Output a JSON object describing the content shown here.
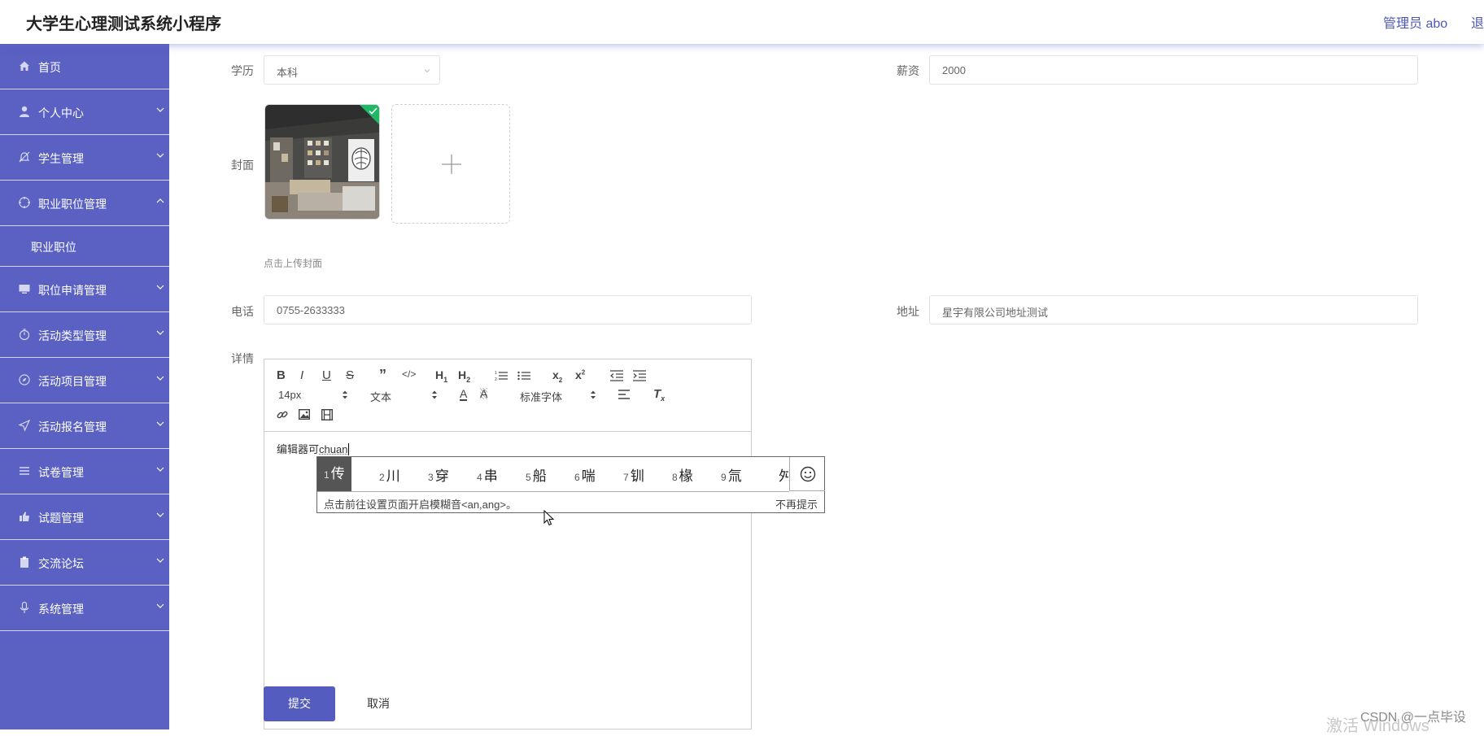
{
  "header": {
    "title": "大学生心理测试系统小程序",
    "user": "管理员 abo",
    "logout": "退"
  },
  "sidebar": {
    "items": [
      {
        "label": "首页",
        "icon": "home-icon"
      },
      {
        "label": "个人中心",
        "icon": "user-icon"
      },
      {
        "label": "学生管理",
        "icon": "bell-off-icon"
      },
      {
        "label": "职业职位管理",
        "icon": "compass-icon"
      },
      {
        "label": "职位申请管理",
        "icon": "monitor-icon"
      },
      {
        "label": "活动类型管理",
        "icon": "stopwatch-icon"
      },
      {
        "label": "活动项目管理",
        "icon": "compass-icon"
      },
      {
        "label": "活动报名管理",
        "icon": "send-icon"
      },
      {
        "label": "试卷管理",
        "icon": "list-icon"
      },
      {
        "label": "试题管理",
        "icon": "thumb-icon"
      },
      {
        "label": "交流论坛",
        "icon": "clipboard-icon"
      },
      {
        "label": "系统管理",
        "icon": "mic-icon"
      }
    ],
    "sub_item": "职业职位"
  },
  "form": {
    "education_label": "学历",
    "education_value": "本科",
    "salary_label": "薪资",
    "salary_value": "2000",
    "cover_label": "封面",
    "cover_hint": "点击上传封面",
    "phone_label": "电话",
    "phone_value": "0755-2633333",
    "address_label": "地址",
    "address_value": "星宇有限公司地址测试",
    "detail_label": "详情"
  },
  "editor": {
    "font_size": "14px",
    "block_type": "文本",
    "font_family": "标准字体",
    "content_prefix": "编辑器可",
    "content_composing": "chuan"
  },
  "ime": {
    "candidates": [
      {
        "n": "1",
        "c": "传"
      },
      {
        "n": "2",
        "c": "川"
      },
      {
        "n": "3",
        "c": "穿"
      },
      {
        "n": "4",
        "c": "串"
      },
      {
        "n": "5",
        "c": "船"
      },
      {
        "n": "6",
        "c": "喘"
      },
      {
        "n": "7",
        "c": "钏"
      },
      {
        "n": "8",
        "c": "椽"
      },
      {
        "n": "9",
        "c": "氚"
      },
      {
        "n": "",
        "c": "舛"
      }
    ],
    "tip": "点击前往设置页面开启模糊音<an,ang>。",
    "dismiss": "不再提示"
  },
  "buttons": {
    "submit": "提交",
    "cancel": "取消"
  },
  "watermark": {
    "csdn": "CSDN @一点毕设",
    "windows": "激活 Windows"
  },
  "colors": {
    "sidebar": "#5a61c2",
    "accent": "#4c57b3",
    "submit": "#555cc0",
    "check": "#1fb866"
  }
}
